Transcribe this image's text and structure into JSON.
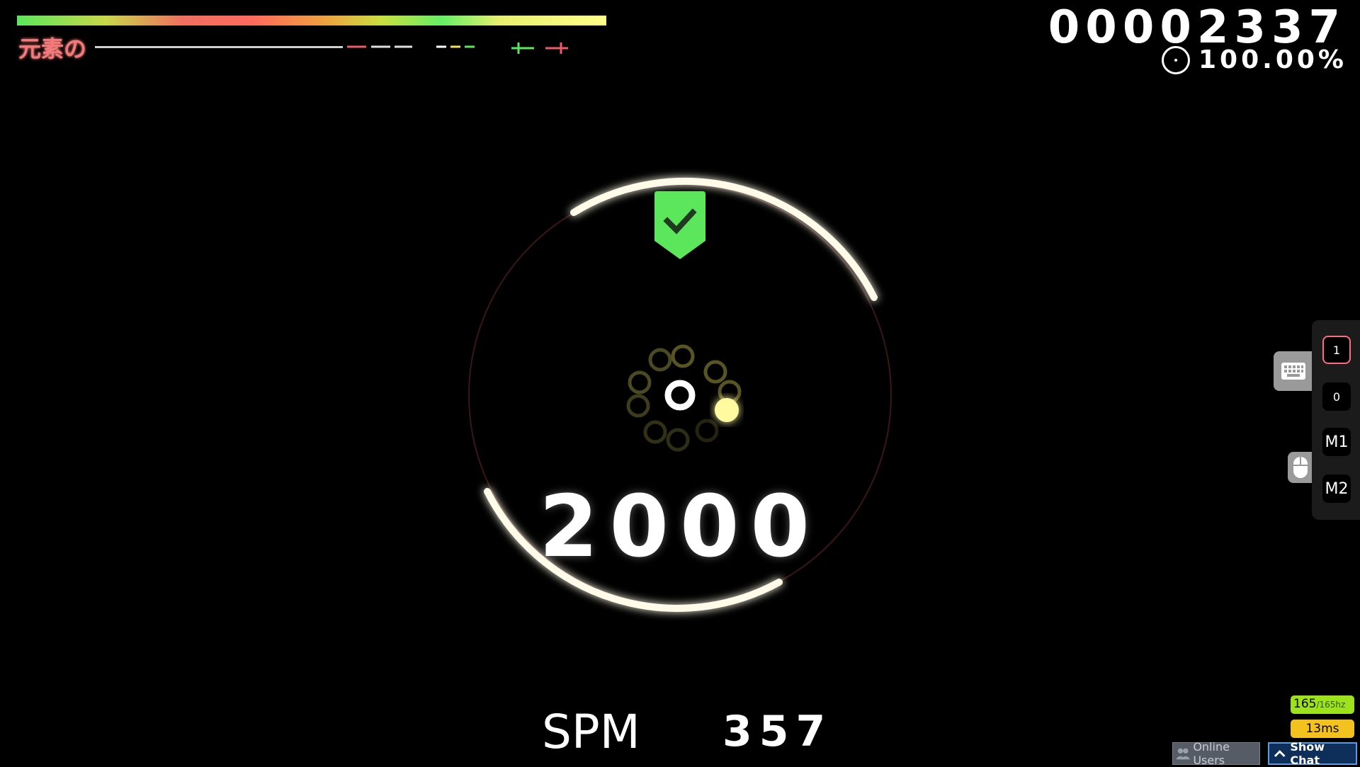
{
  "hud": {
    "song_title": "元素の",
    "score": "00002337",
    "accuracy": "100.00%"
  },
  "spinner": {
    "bonus_score": "2000",
    "state_icon": "check-icon"
  },
  "spm": {
    "label": "SPM",
    "value": "357"
  },
  "key_overlay": {
    "keys": [
      "1",
      "0",
      "M1",
      "M2"
    ],
    "active_key": "1",
    "keyboard_icon": "keyboard-icon",
    "mouse_icon": "mouse-icon"
  },
  "performance": {
    "fps": "165",
    "fps_max": "/165hz",
    "latency": "13ms"
  },
  "bottom_bar": {
    "online_users": "Online Users",
    "show_chat": "Show Chat"
  },
  "colors": {
    "check_green": "#5ce65c",
    "title_pink": "#f37a7a",
    "fps_green": "#9ee21c",
    "latency_yellow": "#f4c21e",
    "chat_blue": "#0e2f59"
  }
}
